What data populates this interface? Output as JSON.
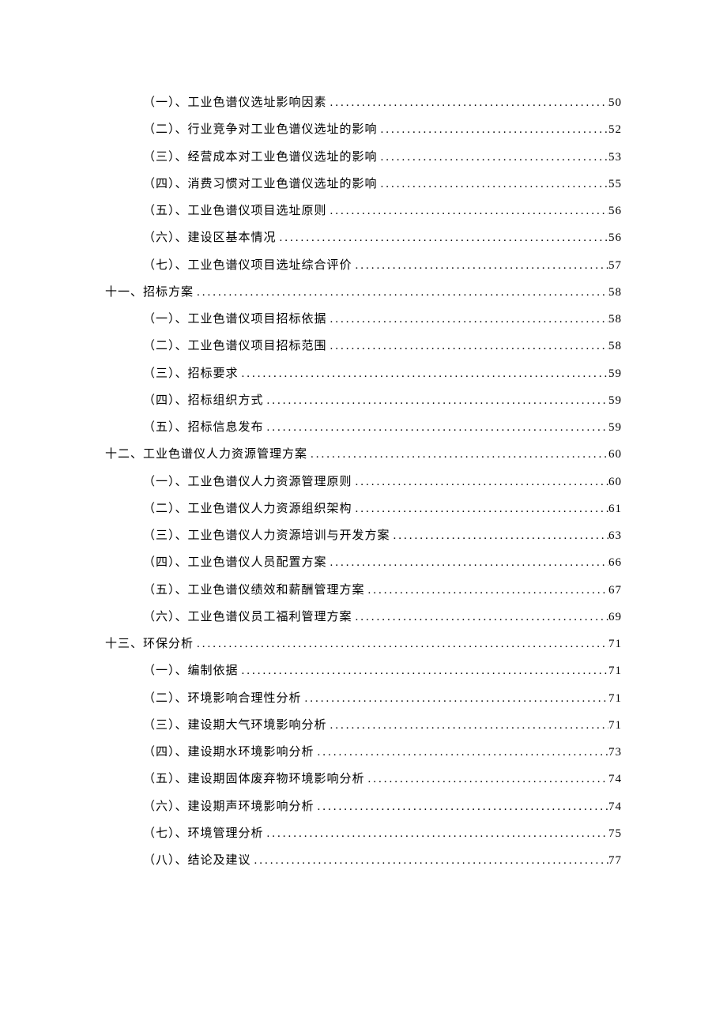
{
  "toc": [
    {
      "level": 2,
      "title": "（一）、工业色谱仪选址影响因素",
      "page": "50"
    },
    {
      "level": 2,
      "title": "（二）、行业竞争对工业色谱仪选址的影响",
      "page": "52"
    },
    {
      "level": 2,
      "title": "（三）、经营成本对工业色谱仪选址的影响",
      "page": "53"
    },
    {
      "level": 2,
      "title": "（四）、消费习惯对工业色谱仪选址的影响",
      "page": "55"
    },
    {
      "level": 2,
      "title": "（五）、工业色谱仪项目选址原则",
      "page": "56"
    },
    {
      "level": 2,
      "title": "（六）、建设区基本情况",
      "page": "56"
    },
    {
      "level": 2,
      "title": "（七）、工业色谱仪项目选址综合评价",
      "page": "57"
    },
    {
      "level": 1,
      "title": "十一、招标方案",
      "page": "58"
    },
    {
      "level": 2,
      "title": "（一）、工业色谱仪项目招标依据",
      "page": "58"
    },
    {
      "level": 2,
      "title": "（二）、工业色谱仪项目招标范围",
      "page": "58"
    },
    {
      "level": 2,
      "title": "（三）、招标要求",
      "page": "59"
    },
    {
      "level": 2,
      "title": "（四）、招标组织方式",
      "page": "59"
    },
    {
      "level": 2,
      "title": "（五）、招标信息发布",
      "page": "59"
    },
    {
      "level": 1,
      "title": "十二、工业色谱仪人力资源管理方案",
      "page": "60"
    },
    {
      "level": 2,
      "title": "（一）、工业色谱仪人力资源管理原则",
      "page": "60"
    },
    {
      "level": 2,
      "title": "（二）、工业色谱仪人力资源组织架构",
      "page": "61"
    },
    {
      "level": 2,
      "title": "（三）、工业色谱仪人力资源培训与开发方案",
      "page": "63"
    },
    {
      "level": 2,
      "title": "（四）、工业色谱仪人员配置方案",
      "page": "66"
    },
    {
      "level": 2,
      "title": "（五）、工业色谱仪绩效和薪酬管理方案",
      "page": "67"
    },
    {
      "level": 2,
      "title": "（六）、工业色谱仪员工福利管理方案",
      "page": "69"
    },
    {
      "level": 1,
      "title": "十三、环保分析",
      "page": "71"
    },
    {
      "level": 2,
      "title": "（一）、编制依据",
      "page": "71"
    },
    {
      "level": 2,
      "title": "（二）、环境影响合理性分析",
      "page": "71"
    },
    {
      "level": 2,
      "title": "（三）、建设期大气环境影响分析",
      "page": "71"
    },
    {
      "level": 2,
      "title": "（四）、建设期水环境影响分析",
      "page": "73"
    },
    {
      "level": 2,
      "title": "（五）、建设期固体废弃物环境影响分析",
      "page": "74"
    },
    {
      "level": 2,
      "title": "（六）、建设期声环境影响分析",
      "page": "74"
    },
    {
      "level": 2,
      "title": "（七）、环境管理分析",
      "page": "75"
    },
    {
      "level": 2,
      "title": "（八）、结论及建议",
      "page": "77"
    }
  ]
}
